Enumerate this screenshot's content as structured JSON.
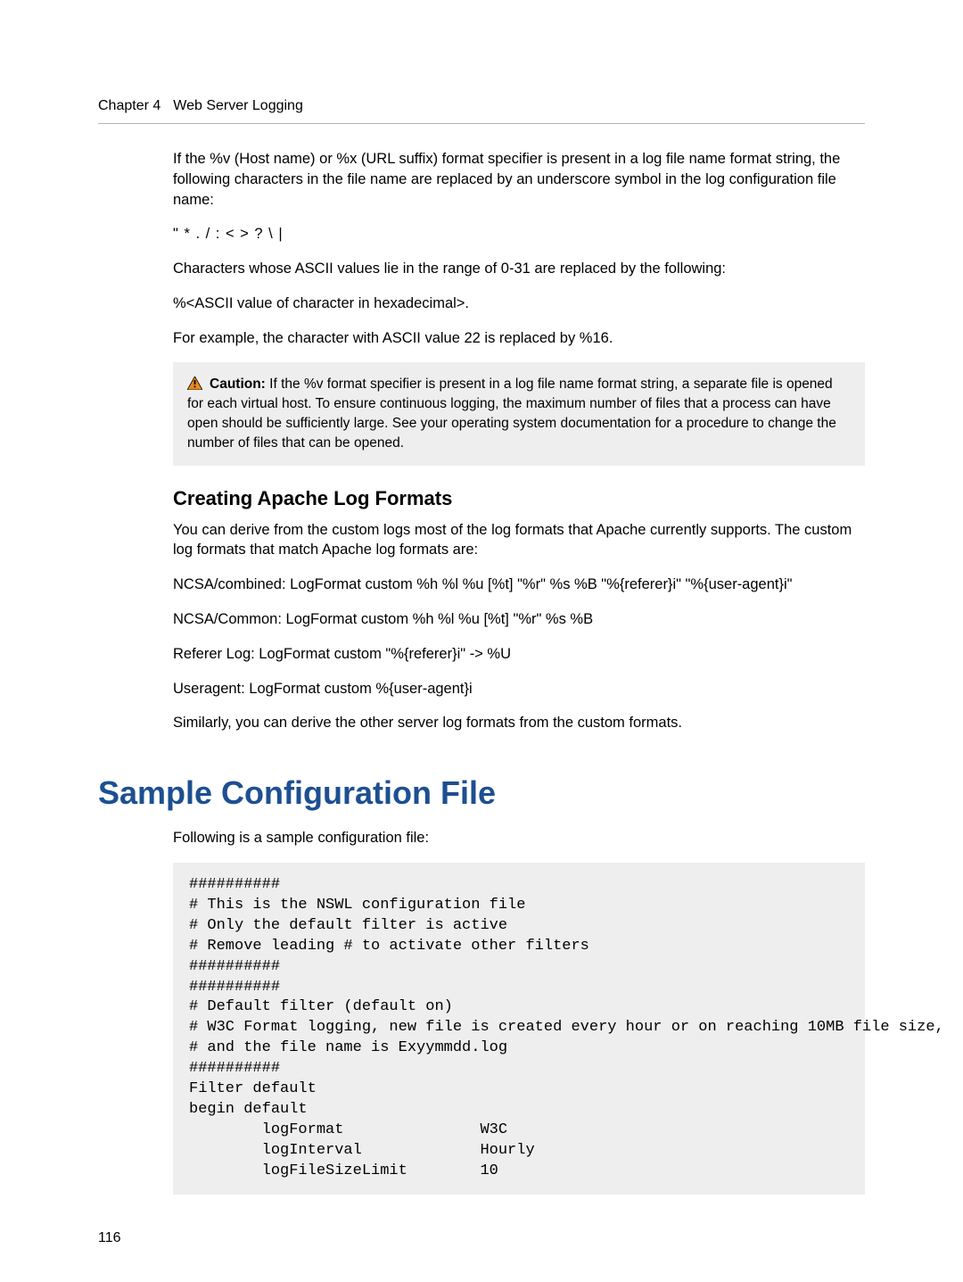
{
  "header": {
    "chapter": "Chapter 4",
    "title": "Web Server Logging"
  },
  "body": {
    "p1": "If the %v (Host name) or %x (URL suffix) format specifier is present in a log file name format string, the following characters in the file name are replaced by an underscore symbol in the log configuration file name:",
    "p2": "\" * . / : < > ? \\ |",
    "p3": "Characters whose ASCII values lie in the range of 0-31 are replaced by the following:",
    "p4": "%<ASCII value of character in hexadecimal>.",
    "p5": "For example, the character with ASCII value 22 is replaced by %16.",
    "caution_label": "Caution:",
    "caution_text": " If the %v format specifier is present in a log file name format string, a separate file is opened for each virtual host. To ensure continuous logging, the maximum number of files that a process can have open should be sufficiently large. See your operating system documentation for a procedure to change the number of files that can be opened.",
    "h2": "Creating Apache Log Formats",
    "p6": "You can derive from the custom logs most of the log formats that Apache currently supports. The custom log formats that match Apache log formats are:",
    "p7": "NCSA/combined: LogFormat custom %h %l %u [%t] \"%r\" %s %B \"%{referer}i\" \"%{user-agent}i\"",
    "p8": "NCSA/Common: LogFormat custom %h %l %u [%t] \"%r\" %s %B",
    "p9": "Referer Log: LogFormat custom \"%{referer}i\" -> %U",
    "p10": "Useragent: LogFormat custom %{user-agent}i",
    "p11": "Similarly, you can derive the other server log formats from the custom formats.",
    "h1": "Sample Configuration File",
    "p12": "Following is a sample configuration file:",
    "code": "##########\n# This is the NSWL configuration file\n# Only the default filter is active\n# Remove leading # to activate other filters\n##########\n##########\n# Default filter (default on)\n# W3C Format logging, new file is created every hour or on reaching 10MB file size,\n# and the file name is Exyymmdd.log\n##########\nFilter default\nbegin default\n        logFormat               W3C\n        logInterval             Hourly\n        logFileSizeLimit        10"
  },
  "footer": {
    "page_number": "116"
  }
}
